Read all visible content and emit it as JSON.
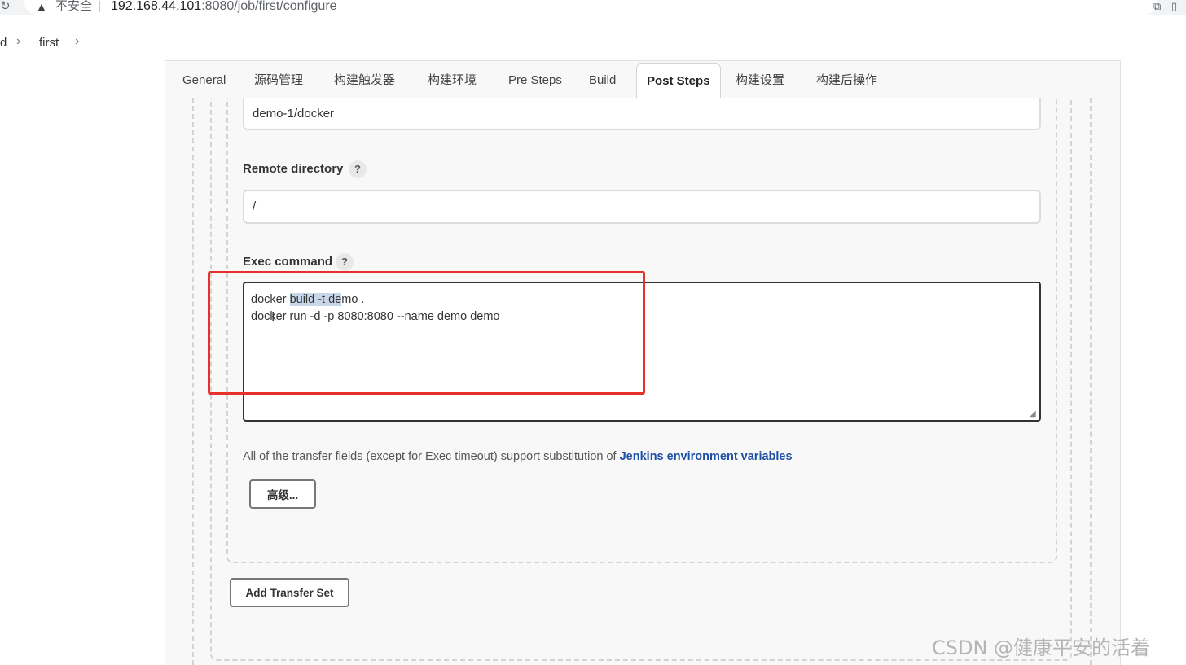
{
  "browser": {
    "security_label": "不安全",
    "separator": "|",
    "url_host": "192.168.44.101",
    "url_path": ":8080/job/first/configure"
  },
  "breadcrumb": {
    "prev": "d",
    "current": "first"
  },
  "tabs": [
    {
      "label": "General"
    },
    {
      "label": "源码管理"
    },
    {
      "label": "构建触发器"
    },
    {
      "label": "构建环境"
    },
    {
      "label": "Pre Steps"
    },
    {
      "label": "Build"
    },
    {
      "label": "Post Steps"
    },
    {
      "label": "构建设置"
    },
    {
      "label": "构建后操作"
    }
  ],
  "active_tab": "Post Steps",
  "form": {
    "source_files_value": "demo-1/docker",
    "remote_directory_label": "Remote directory",
    "remote_directory_value": "/",
    "exec_command_label": "Exec command",
    "help_glyph": "?",
    "exec_command": {
      "line1_pre": "docker ",
      "line1_sel": "build -t de",
      "line1_post": "mo .",
      "line2": "docker run -d -p 8080:8080 --name demo demo"
    },
    "hint_text": "All of the transfer fields (except for Exec timeout) support substitution of ",
    "hint_link": "Jenkins environment variables",
    "advanced_button": "高级...",
    "add_transfer_set_button": "Add Transfer Set"
  },
  "watermark": "CSDN @健康平安的活着",
  "colors": {
    "annotation_red": "#e8302a",
    "link_blue": "#1d4fa3",
    "selection": "#c8d6ea"
  }
}
